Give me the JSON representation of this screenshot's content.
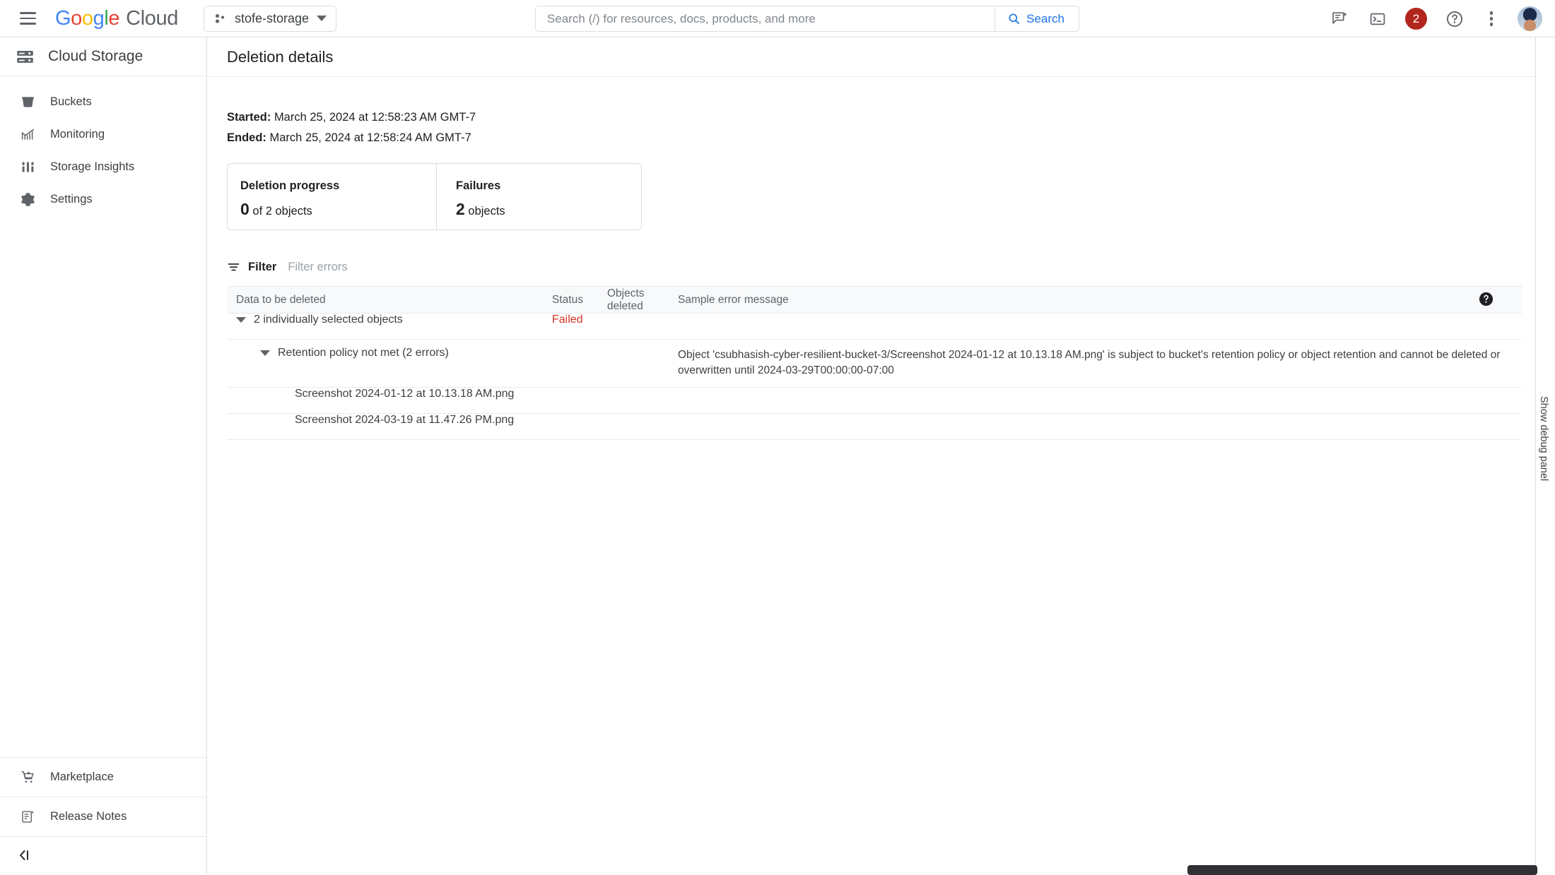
{
  "topbar": {
    "menu_icon": "hamburger-icon",
    "logo": {
      "google": "Google",
      "cloud": "Cloud"
    },
    "project": {
      "name": "stofe-storage",
      "icon": "project-nodes-icon",
      "caret": "chevron-down-icon"
    },
    "search": {
      "placeholder": "Search (/) for resources, docs, products, and more",
      "value": "",
      "button_label": "Search",
      "icon": "search-icon"
    },
    "icons": {
      "gemini": "gemini-chat-icon",
      "cloud_shell": "cloud-shell-terminal-icon",
      "notifications_count": "2",
      "help": "help-circle-icon",
      "more": "more-vert-icon",
      "avatar": "user-avatar"
    }
  },
  "sidebar": {
    "product_title": "Cloud Storage",
    "product_icon": "storage-rack-icon",
    "items": [
      {
        "label": "Buckets",
        "icon": "bucket-icon"
      },
      {
        "label": "Monitoring",
        "icon": "monitoring-chart-icon"
      },
      {
        "label": "Storage Insights",
        "icon": "insights-bars-icon"
      },
      {
        "label": "Settings",
        "icon": "gear-icon"
      }
    ],
    "bottom_items": [
      {
        "label": "Marketplace",
        "icon": "marketplace-cart-icon"
      },
      {
        "label": "Release Notes",
        "icon": "release-notes-icon"
      }
    ],
    "collapse_icon": "collapse-left-icon"
  },
  "page": {
    "title": "Deletion details",
    "started_label": "Started:",
    "started_value": "March 25, 2024 at 12:58:23 AM GMT-7",
    "ended_label": "Ended:",
    "ended_value": "March 25, 2024 at 12:58:24 AM GMT-7"
  },
  "stats": {
    "progress_label": "Deletion progress",
    "progress_value": "0",
    "progress_suffix": "of 2 objects",
    "failures_label": "Failures",
    "failures_value": "2",
    "failures_suffix": "objects"
  },
  "filter": {
    "button_label": "Filter",
    "icon": "filter-icon",
    "placeholder": "Filter errors",
    "value": "",
    "help_icon": "help-filled-icon"
  },
  "table": {
    "columns": [
      "Data to be deleted",
      "Status",
      "Objects deleted",
      "Sample error message"
    ],
    "rows": [
      {
        "type": "group",
        "name": "2 individually selected objects",
        "status": "Failed",
        "objects_deleted": "",
        "error": ""
      },
      {
        "type": "subgroup",
        "name": "Retention policy not met (2 errors)",
        "status": "",
        "objects_deleted": "",
        "error": "Object 'csubhasish-cyber-resilient-bucket-3/Screenshot 2024-01-12 at 10.13.18 AM.png' is subject to bucket's retention policy or object retention and cannot be deleted or overwritten until 2024-03-29T00:00:00-07:00"
      },
      {
        "type": "leaf",
        "name": "Screenshot 2024-01-12 at 10.13.18 AM.png",
        "status": "",
        "objects_deleted": "",
        "error": ""
      },
      {
        "type": "leaf",
        "name": "Screenshot 2024-03-19 at 11.47.26 PM.png",
        "status": "",
        "objects_deleted": "",
        "error": ""
      }
    ]
  },
  "debug": {
    "label": "Show debug panel"
  },
  "colors": {
    "accent_blue": "#1a73e8",
    "error_red": "#d93025",
    "badge_red": "#b3261e",
    "text_primary": "#202124",
    "text_secondary": "#5f6368",
    "border": "#dadce0"
  }
}
